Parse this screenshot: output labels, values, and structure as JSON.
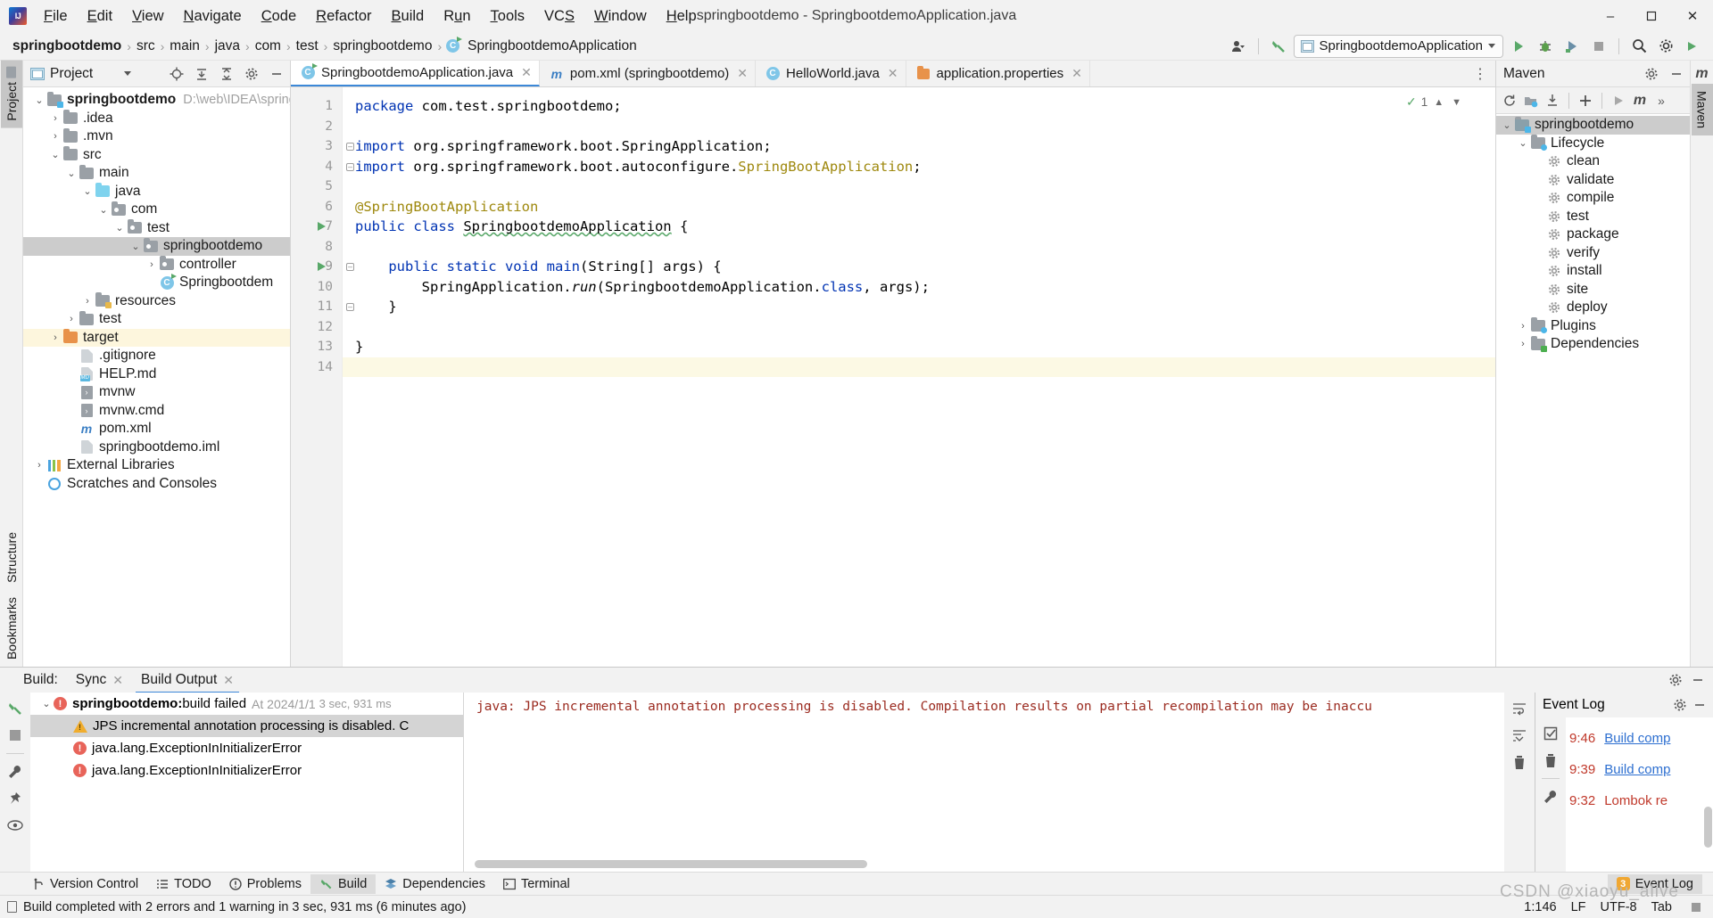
{
  "titlebar": {
    "app_icon": "intellij-logo",
    "window_title": "springbootdemo - SpringbootdemoApplication.java",
    "menus": [
      "File",
      "Edit",
      "View",
      "Navigate",
      "Code",
      "Refactor",
      "Build",
      "Run",
      "Tools",
      "VCS",
      "Window",
      "Help"
    ],
    "minimize": "–",
    "maximize": "❐",
    "close": "✕"
  },
  "navbar": {
    "crumbs": [
      "springbootdemo",
      "src",
      "main",
      "java",
      "com",
      "test",
      "springbootdemo",
      "SpringbootdemoApplication"
    ],
    "separator": "›",
    "run_config": "SpringbootdemoApplication",
    "icons": [
      "user-avatar-icon",
      "hammer-build-icon",
      "run-icon",
      "debug-icon",
      "run-coverage-icon",
      "stop-icon",
      "search-icon",
      "settings-icon",
      "updates-icon"
    ]
  },
  "left_stripe": {
    "tabs": [
      "Project",
      "Structure",
      "Bookmarks"
    ],
    "active": "Project"
  },
  "project_panel": {
    "title": "Project",
    "toolbar_icons": [
      "locate-icon",
      "expand-all-icon",
      "collapse-all-icon",
      "settings-icon",
      "hide-icon"
    ],
    "tree": [
      {
        "depth": 0,
        "twist": "⌄",
        "icon": "module-folder",
        "label": "springbootdemo",
        "bold": true,
        "path": "D:\\web\\IDEA\\spring"
      },
      {
        "depth": 1,
        "twist": "›",
        "icon": "folder",
        "label": ".idea"
      },
      {
        "depth": 1,
        "twist": "›",
        "icon": "folder",
        "label": ".mvn"
      },
      {
        "depth": 1,
        "twist": "⌄",
        "icon": "folder",
        "label": "src"
      },
      {
        "depth": 2,
        "twist": "⌄",
        "icon": "folder",
        "label": "main"
      },
      {
        "depth": 3,
        "twist": "⌄",
        "icon": "source-folder",
        "label": "java"
      },
      {
        "depth": 4,
        "twist": "⌄",
        "icon": "package",
        "label": "com"
      },
      {
        "depth": 5,
        "twist": "⌄",
        "icon": "package",
        "label": "test"
      },
      {
        "depth": 6,
        "twist": "⌄",
        "icon": "package",
        "label": "springbootdemo",
        "selected": true
      },
      {
        "depth": 7,
        "twist": "›",
        "icon": "package",
        "label": "controller"
      },
      {
        "depth": 7,
        "twist": "",
        "icon": "java-class-runnable",
        "label": "Springbootdem"
      },
      {
        "depth": 3,
        "twist": "›",
        "icon": "resources-folder",
        "label": "resources"
      },
      {
        "depth": 2,
        "twist": "›",
        "icon": "folder",
        "label": "test"
      },
      {
        "depth": 1,
        "twist": "›",
        "icon": "excluded-folder",
        "label": "target",
        "highlight": true
      },
      {
        "depth": 2,
        "twist": "",
        "icon": "gitignore-file",
        "label": ".gitignore"
      },
      {
        "depth": 2,
        "twist": "",
        "icon": "markdown-file",
        "label": "HELP.md"
      },
      {
        "depth": 2,
        "twist": "",
        "icon": "shell-file",
        "label": "mvnw"
      },
      {
        "depth": 2,
        "twist": "",
        "icon": "shell-file",
        "label": "mvnw.cmd"
      },
      {
        "depth": 2,
        "twist": "",
        "icon": "maven-file",
        "label": "pom.xml"
      },
      {
        "depth": 2,
        "twist": "",
        "icon": "iml-file",
        "label": "springbootdemo.iml"
      },
      {
        "depth": 0,
        "twist": "›",
        "icon": "libraries",
        "label": "External Libraries"
      },
      {
        "depth": 0,
        "twist": "",
        "icon": "scratches",
        "label": "Scratches and Consoles"
      }
    ]
  },
  "editor": {
    "tabs": [
      {
        "label": "SpringbootdemoApplication.java",
        "icon": "java-class-runnable",
        "active": true,
        "close": "✕"
      },
      {
        "label": "pom.xml (springbootdemo)",
        "icon": "maven-file",
        "active": false,
        "close": "✕"
      },
      {
        "label": "HelloWorld.java",
        "icon": "java-class",
        "active": false,
        "close": "✕"
      },
      {
        "label": "application.properties",
        "icon": "properties-file",
        "active": false,
        "close": "✕"
      }
    ],
    "tabbar_more": "⋮",
    "inspection_count": "1",
    "inspection_icon": "inspection-ok-icon",
    "gutter_lines": [
      "1",
      "2",
      "3",
      "4",
      "5",
      "6",
      "7",
      "8",
      "9",
      "10",
      "11",
      "12",
      "13",
      "14"
    ],
    "current_line": 14,
    "run_markers": [
      7,
      9
    ],
    "code_lines": [
      {
        "n": 1,
        "tokens": [
          {
            "t": "package",
            "c": "kw"
          },
          {
            "t": " com.test.springbootdemo;",
            "c": ""
          }
        ]
      },
      {
        "n": 2,
        "tokens": []
      },
      {
        "n": 3,
        "tokens": [
          {
            "t": "import",
            "c": "kw"
          },
          {
            "t": " org.springframework.boot.SpringApplication;",
            "c": ""
          }
        ]
      },
      {
        "n": 4,
        "tokens": [
          {
            "t": "import",
            "c": "kw"
          },
          {
            "t": " org.springframework.boot.autoconfigure.",
            "c": ""
          },
          {
            "t": "SpringBootApplication",
            "c": "ann"
          },
          {
            "t": ";",
            "c": ""
          }
        ]
      },
      {
        "n": 5,
        "tokens": []
      },
      {
        "n": 6,
        "tokens": [
          {
            "t": "@SpringBootApplication",
            "c": "ann"
          }
        ]
      },
      {
        "n": 7,
        "tokens": [
          {
            "t": "public class",
            "c": "kw"
          },
          {
            "t": " ",
            "c": ""
          },
          {
            "t": "SpringbootdemoApplication",
            "c": "err-und"
          },
          {
            "t": " {",
            "c": ""
          }
        ]
      },
      {
        "n": 8,
        "tokens": []
      },
      {
        "n": 9,
        "tokens": [
          {
            "t": "    ",
            "c": ""
          },
          {
            "t": "public static void",
            "c": "kw"
          },
          {
            "t": " ",
            "c": ""
          },
          {
            "t": "main",
            "c": "kw"
          },
          {
            "t": "(String[] args) {",
            "c": ""
          }
        ]
      },
      {
        "n": 10,
        "tokens": [
          {
            "t": "        SpringApplication.",
            "c": ""
          },
          {
            "t": "run",
            "c": "ital"
          },
          {
            "t": "(SpringbootdemoApplication.",
            "c": ""
          },
          {
            "t": "class",
            "c": "kw"
          },
          {
            "t": ", args);",
            "c": ""
          }
        ]
      },
      {
        "n": 11,
        "tokens": [
          {
            "t": "    }",
            "c": ""
          }
        ]
      },
      {
        "n": 12,
        "tokens": []
      },
      {
        "n": 13,
        "tokens": [
          {
            "t": "}",
            "c": ""
          }
        ]
      },
      {
        "n": 14,
        "tokens": []
      }
    ]
  },
  "maven_panel": {
    "title": "Maven",
    "header_icons": [
      "settings-icon",
      "hide-icon"
    ],
    "toolbar_icons": [
      "reload-icon",
      "add-module-icon",
      "download-sources-icon",
      "plus-icon",
      "execute-icon",
      "maven-m-icon",
      "more-icon"
    ],
    "tree": [
      {
        "depth": 0,
        "twist": "⌄",
        "icon": "maven-project-icon",
        "label": "springbootdemo",
        "selected": true
      },
      {
        "depth": 1,
        "twist": "⌄",
        "icon": "lifecycle-folder-icon",
        "label": "Lifecycle"
      },
      {
        "depth": 2,
        "twist": "",
        "icon": "goal-gear-icon",
        "label": "clean"
      },
      {
        "depth": 2,
        "twist": "",
        "icon": "goal-gear-icon",
        "label": "validate"
      },
      {
        "depth": 2,
        "twist": "",
        "icon": "goal-gear-icon",
        "label": "compile"
      },
      {
        "depth": 2,
        "twist": "",
        "icon": "goal-gear-icon",
        "label": "test"
      },
      {
        "depth": 2,
        "twist": "",
        "icon": "goal-gear-icon",
        "label": "package"
      },
      {
        "depth": 2,
        "twist": "",
        "icon": "goal-gear-icon",
        "label": "verify"
      },
      {
        "depth": 2,
        "twist": "",
        "icon": "goal-gear-icon",
        "label": "install"
      },
      {
        "depth": 2,
        "twist": "",
        "icon": "goal-gear-icon",
        "label": "site"
      },
      {
        "depth": 2,
        "twist": "",
        "icon": "goal-gear-icon",
        "label": "deploy"
      },
      {
        "depth": 1,
        "twist": "›",
        "icon": "plugins-folder-icon",
        "label": "Plugins"
      },
      {
        "depth": 1,
        "twist": "›",
        "icon": "dependencies-folder-icon",
        "label": "Dependencies"
      }
    ]
  },
  "right_stripe": {
    "tabs": [
      "Maven"
    ],
    "active": "Maven",
    "m_icon": "maven-m-icon"
  },
  "build_panel": {
    "label": "Build:",
    "tabs": [
      {
        "label": "Sync",
        "active": false,
        "close": "✕"
      },
      {
        "label": "Build Output",
        "active": true,
        "close": "✕"
      }
    ],
    "header_icons": [
      "settings-icon",
      "hide-icon"
    ],
    "left_tool_icons": [
      "build-hammer-icon",
      "stop-icon",
      "wrench-icon"
    ],
    "right_tool_icons": [
      "soft-wrap-icon",
      "scroll-to-end-icon",
      "trash-icon"
    ],
    "tree": [
      {
        "depth": 0,
        "twist": "⌄",
        "icon": "error-icon",
        "label_bold": "springbootdemo:",
        "label": " build failed",
        "meta": "At 2024/1/1",
        "meta2": "3 sec, 931 ms"
      },
      {
        "depth": 1,
        "twist": "",
        "icon": "warning-icon",
        "label": "JPS incremental annotation processing is disabled. C",
        "selected": true
      },
      {
        "depth": 1,
        "twist": "",
        "icon": "error-icon",
        "label": "java.lang.ExceptionInInitializerError"
      },
      {
        "depth": 1,
        "twist": "",
        "icon": "error-icon",
        "label": "java.lang.ExceptionInInitializerError"
      }
    ],
    "console_text": "java: JPS incremental annotation processing is disabled. Compilation results on partial recompilation may be inaccu"
  },
  "event_log": {
    "title": "Event Log",
    "header_icons": [
      "settings-icon",
      "hide-icon"
    ],
    "tool_icons": [
      "mark-read-icon",
      "trash-icon",
      "wrench-icon"
    ],
    "entries": [
      {
        "time": "9:32",
        "text": "Lombok re",
        "link": false
      },
      {
        "time": "9:39",
        "text": "Build comp",
        "link": true
      },
      {
        "time": "9:46",
        "text": "Build comp",
        "link": true
      }
    ]
  },
  "toolwindow_bar": {
    "items": [
      {
        "label": "Version Control",
        "icon": "vcs-branch-icon",
        "active": false
      },
      {
        "label": "TODO",
        "icon": "todo-list-icon",
        "active": false
      },
      {
        "label": "Problems",
        "icon": "problems-icon",
        "active": false
      },
      {
        "label": "Build",
        "icon": "build-hammer-icon",
        "active": true
      },
      {
        "label": "Dependencies",
        "icon": "dependencies-icon",
        "active": false
      },
      {
        "label": "Terminal",
        "icon": "terminal-icon",
        "active": false
      }
    ],
    "event_log": {
      "label": "Event Log",
      "badge": "3"
    }
  },
  "statusbar": {
    "message": "Build completed with 2 errors and 1 warning in 3 sec, 931 ms (6 minutes ago)",
    "message_icon": "memory-indicator-icon",
    "caret": "1:146",
    "line_sep": "LF",
    "encoding": "UTF-8",
    "indent": "Tab",
    "watermark": "CSDN @xiaoyu_alive"
  }
}
